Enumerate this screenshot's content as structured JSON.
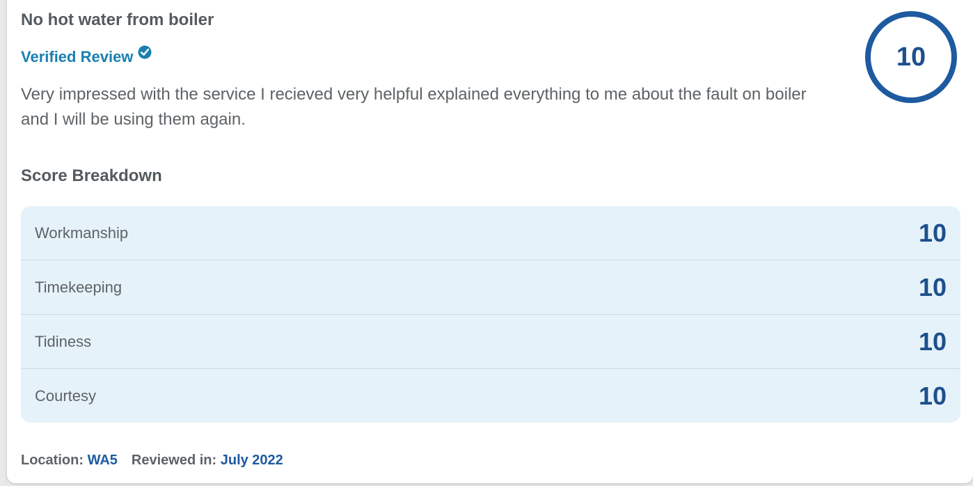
{
  "review": {
    "title": "No hot water from boiler",
    "verified_label": "Verified Review",
    "verified_icon": "verified-check-icon",
    "text": "Very impressed with the service I recieved very helpful explained everything to me about the fault on boiler and I will be using them again.",
    "overall_score": "10"
  },
  "breakdown": {
    "heading": "Score Breakdown",
    "items": [
      {
        "label": "Workmanship",
        "score": "10"
      },
      {
        "label": "Timekeeping",
        "score": "10"
      },
      {
        "label": "Tidiness",
        "score": "10"
      },
      {
        "label": "Courtesy",
        "score": "10"
      }
    ]
  },
  "meta": {
    "location_label": "Location:",
    "location_value": "WA5",
    "reviewed_label": "Reviewed in:",
    "reviewed_value": "July 2022"
  },
  "colors": {
    "accent_blue": "#1d5aa0",
    "verified_blue": "#1a7fb0",
    "breakdown_bg": "#e6f2f9"
  }
}
